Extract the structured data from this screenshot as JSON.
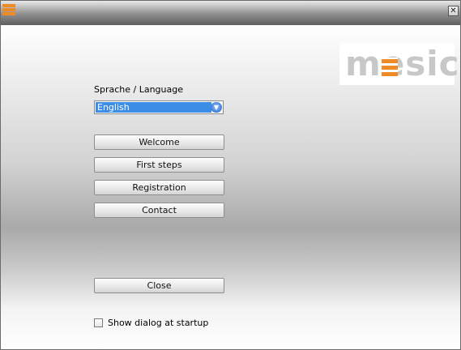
{
  "window": {
    "title": "",
    "close_glyph": "✕"
  },
  "logo": {
    "text": "mesics",
    "accent_color": "#f08a24",
    "text_color": "#c8c8c8"
  },
  "language": {
    "label": "Sprache / Language",
    "selected": "English"
  },
  "buttons": {
    "welcome": "Welcome",
    "first_steps": "First steps",
    "registration": "Registration",
    "contact": "Contact",
    "close": "Close"
  },
  "startup_option": {
    "label": "Show dialog at startup",
    "checked": false
  },
  "colors": {
    "selection": "#3b8de6",
    "app_icon": "#f08a24"
  }
}
